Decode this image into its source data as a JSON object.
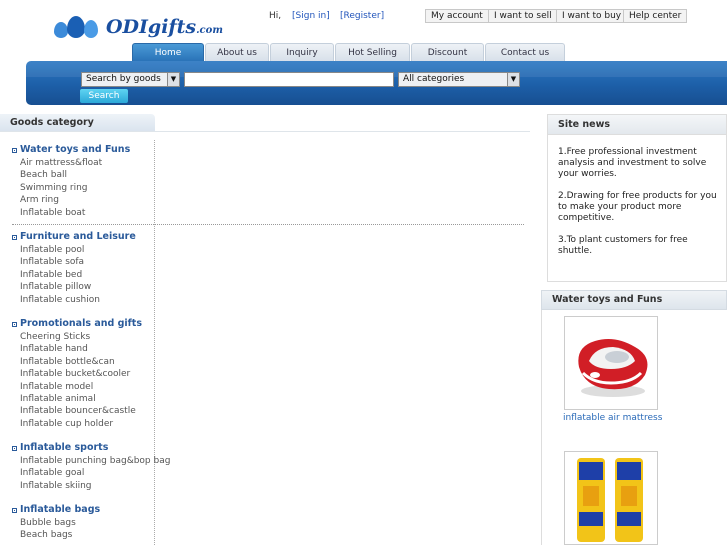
{
  "brand": {
    "name": "ODIgifts",
    "suffix": ".com"
  },
  "user_bar": {
    "greeting": "Hi,",
    "sign_in": "[Sign in]",
    "register": "[Register]",
    "buttons": [
      "My account",
      "I want to sell",
      "I want to buy",
      "Help center"
    ]
  },
  "nav": {
    "tabs": [
      "Home",
      "About us",
      "Inquiry",
      "Hot Selling",
      "Discount",
      "Contact us"
    ],
    "active": "Home"
  },
  "search": {
    "mode": "Search by goods",
    "keyword": "",
    "category": "All categories",
    "button": "Search"
  },
  "category_panel": {
    "title": "Goods category",
    "groups": [
      {
        "title": "Water toys and Funs",
        "items": [
          "Air mattress&float",
          "Beach ball",
          "Swimming ring",
          "Arm ring",
          "Inflatable boat"
        ]
      },
      {
        "title": "Furniture and Leisure",
        "items": [
          "Inflatable pool",
          "Inflatable sofa",
          "Inflatable bed",
          "Inflatable pillow",
          "Inflatable cushion"
        ]
      },
      {
        "title": "Promotionals and gifts",
        "items": [
          "Cheering Sticks",
          "Inflatable hand",
          "Inflatable bottle&can",
          "Inflatable bucket&cooler",
          "Inflatable model",
          "Inflatable animal",
          "Inflatable bouncer&castle",
          "Inflatable cup holder"
        ]
      },
      {
        "title": "Inflatable sports",
        "items": [
          "Inflatable punching bag&bop bag",
          "Inflatable goal",
          "Inflatable skiing"
        ]
      },
      {
        "title": "Inflatable bags",
        "items": [
          "Bubble bags",
          "Beach bags"
        ]
      }
    ]
  },
  "site_news": {
    "title": "Site news",
    "items": [
      "1.Free professional investment analysis and investment to solve your worries.",
      "2.Drawing for free products for you to make your product more competitive.",
      "3.To plant customers for free shuttle."
    ]
  },
  "featured": {
    "title": "Water toys and Funs",
    "products": [
      {
        "name": "inflatable air mattress"
      }
    ]
  },
  "colors": {
    "accent": "#1d5fa8",
    "link": "#2a5a9a",
    "active_tab": "#2a73b8"
  }
}
